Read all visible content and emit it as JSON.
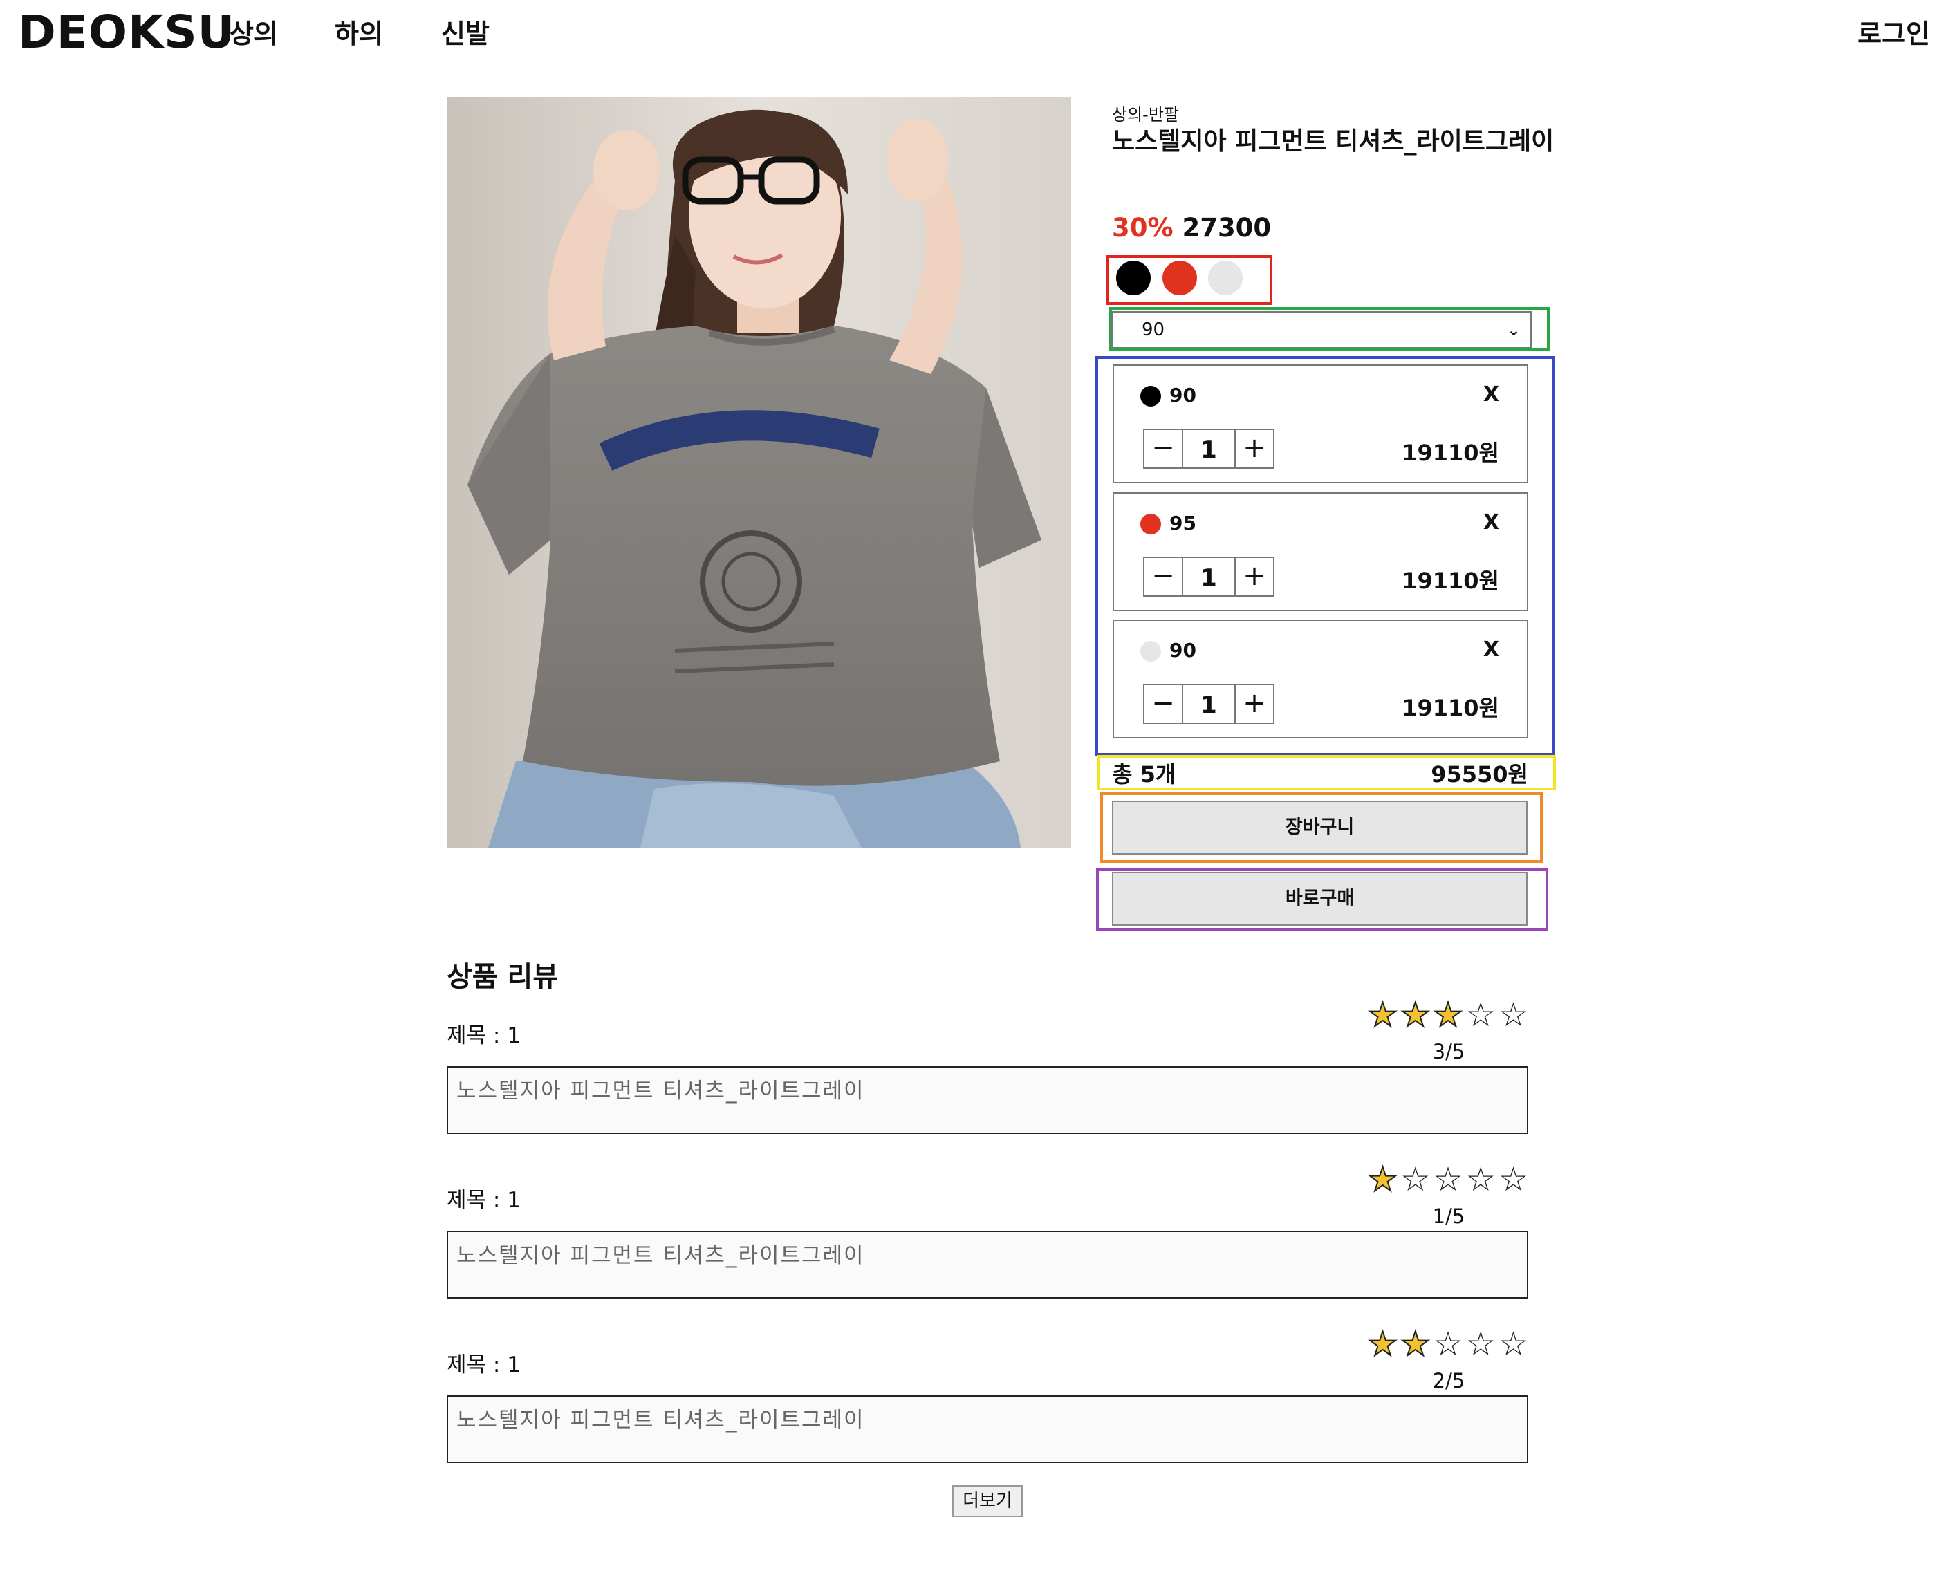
{
  "header": {
    "logo": "DEOKSU",
    "nav": [
      "상의",
      "하의",
      "신발"
    ],
    "login": "로그인"
  },
  "product": {
    "category": "상의-반팔",
    "name": "노스텔지아 피그먼트 티셔츠_라이트그레이",
    "discount": "30%",
    "price": "27300",
    "colors": [
      {
        "name": "black",
        "hex": "#000000"
      },
      {
        "name": "red",
        "hex": "#e0321e"
      },
      {
        "name": "lightgray",
        "hex": "#e6e6e6"
      }
    ],
    "selected_size": "90",
    "options": [
      {
        "color": "#000000",
        "size": "90",
        "qty": "1",
        "price": "19110원",
        "remove": "X"
      },
      {
        "color": "#e0321e",
        "size": "95",
        "qty": "1",
        "price": "19110원",
        "remove": "X"
      },
      {
        "color": "#e6e6e6",
        "size": "90",
        "qty": "1",
        "price": "19110원",
        "remove": "X"
      }
    ],
    "total_count": "총 5개",
    "total_price": "95550원",
    "cart_label": "장바구니",
    "buy_label": "바로구매"
  },
  "reviews": {
    "heading": "상품 리뷰",
    "items": [
      {
        "title": "제목 : 1",
        "rating": "3/5",
        "stars": 3,
        "body": "노스텔지아 피그먼트 티셔츠_라이트그레이"
      },
      {
        "title": "제목 : 1",
        "rating": "1/5",
        "stars": 1,
        "body": "노스텔지아 피그먼트 티셔츠_라이트그레이"
      },
      {
        "title": "제목 : 1",
        "rating": "2/5",
        "stars": 2,
        "body": "노스텔지아 피그먼트 티셔츠_라이트그레이"
      }
    ],
    "more_label": "더보기"
  },
  "annotation_colors": {
    "color_picker": "#e0251f",
    "size_select": "#27a845",
    "selected_options": "#3a48c8",
    "total": "#f5e625",
    "cart": "#f08a2a",
    "buy": "#9a45b8"
  }
}
